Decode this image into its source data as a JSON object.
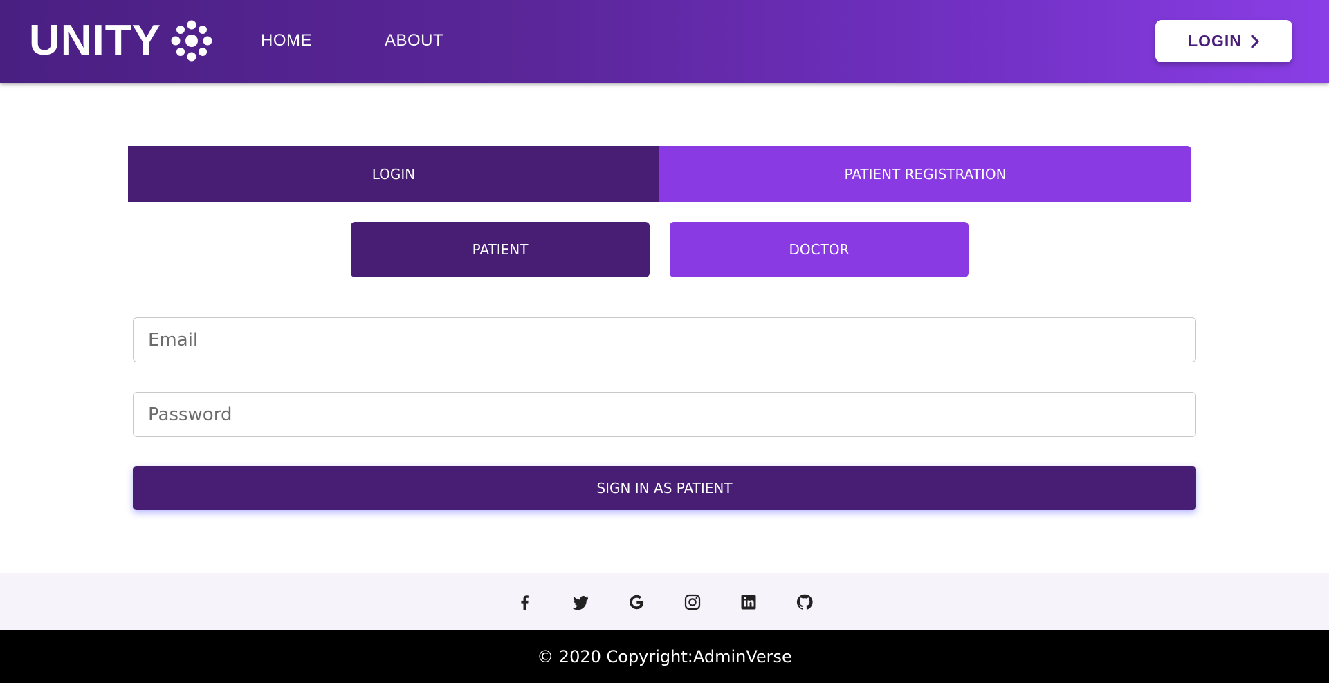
{
  "navbar": {
    "brand": "UNITY",
    "brand_logo_icon": "dots-cluster-icon",
    "links": [
      {
        "label": "HOME"
      },
      {
        "label": "ABOUT"
      }
    ],
    "login_button": {
      "label": "LOGIN",
      "icon": "chevron-right-icon"
    }
  },
  "tabs": [
    {
      "label": "LOGIN",
      "active": true
    },
    {
      "label": "PATIENT REGISTRATION",
      "active": false
    }
  ],
  "roles": [
    {
      "label": "PATIENT",
      "active": true
    },
    {
      "label": "DOCTOR",
      "active": false
    }
  ],
  "form": {
    "email_placeholder": "Email",
    "email_value": "",
    "password_placeholder": "Password",
    "password_value": "",
    "submit_label": "SIGN IN AS PATIENT"
  },
  "social_icons": [
    "facebook-icon",
    "twitter-icon",
    "google-icon",
    "instagram-icon",
    "linkedin-icon",
    "github-icon"
  ],
  "footer": {
    "copyright": "© 2020 Copyright:AdminVerse"
  },
  "colors": {
    "primary_dark": "#481e74",
    "primary_light": "#8a3ae2",
    "footer_bg": "#000000",
    "social_bg": "#f6f3fb"
  }
}
